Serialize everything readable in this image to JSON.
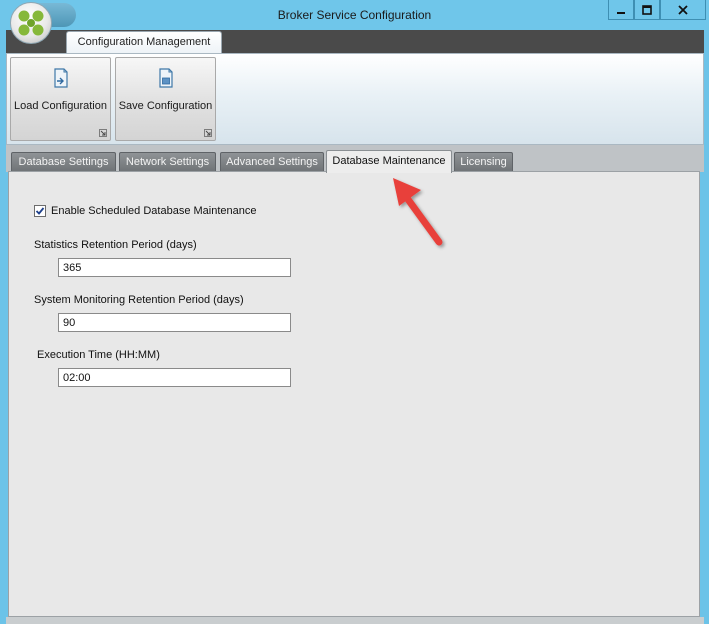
{
  "window": {
    "title": "Broker Service Configuration",
    "accent_color": "#6fc6ea",
    "controls": [
      "minimize-icon",
      "maximize-icon",
      "close-icon"
    ]
  },
  "ribbon": {
    "tab_label": "Configuration Management",
    "buttons": [
      {
        "label": "Load Configuration",
        "icon": "load-config-icon"
      },
      {
        "label": "Save Configuration",
        "icon": "save-config-icon"
      }
    ]
  },
  "tabs": [
    {
      "label": "Database Settings",
      "active": false
    },
    {
      "label": "Network Settings",
      "active": false
    },
    {
      "label": "Advanced Settings",
      "active": false
    },
    {
      "label": "Database Maintenance",
      "active": true
    },
    {
      "label": "Licensing",
      "active": false
    }
  ],
  "form": {
    "enable_label": "Enable Scheduled Database Maintenance",
    "enable_checked": true,
    "stats_label": "Statistics Retention Period (days)",
    "stats_value": "365",
    "monitoring_label": "System Monitoring Retention Period (days)",
    "monitoring_value": "90",
    "exec_label": "Execution Time (HH:MM)",
    "exec_value": "02:00"
  },
  "annotation": {
    "arrow_color": "#e8403a"
  }
}
